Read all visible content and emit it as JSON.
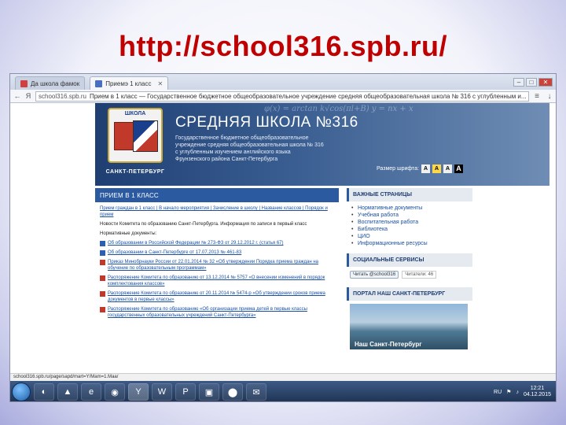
{
  "slide": {
    "title": "http://school316.spb.ru/"
  },
  "browser": {
    "tabs": [
      {
        "label": "Да школа фамок",
        "active": false
      },
      {
        "label": "Приемэ 1 класс",
        "active": true
      }
    ],
    "url_host": "school316.spb.ru",
    "url_title": "Прием в 1 класс — Государственное бюджетное общеобразовательное учреждение средняя общеобразовательная школа № 316 с углубленным и...",
    "status_text": "school316.spb.ru/page/sapd/mart=Y/Mam=1.Maa/"
  },
  "site": {
    "header_formulas": "φ(x) = arctan   k√cos(πl+B)   y = nx + x",
    "emblem_top": "ШКОЛА",
    "emblem_num": "316",
    "city": "САНКТ-ПЕТЕРБУРГ",
    "school_name": "СРЕДНЯЯ ШКОЛА №316",
    "school_desc": "Государственное бюджетное общеобразовательное учреждение средняя общеобразовательная школа № 316 с углубленным изучением английского языка Фрунзенского района Санкт-Петербурга",
    "font_size_label": "Размер шрифта:",
    "font_btns": [
      "А",
      "А",
      "А",
      "А"
    ]
  },
  "main": {
    "heading": "ПРИЕМ В 1 КЛАСС",
    "links_line": "Прием граждан в 1 класс | В начало мероприятия | Зачисление в школу | Название классов | Порядок и прием",
    "committee": "Новости Комитета по образованию Санкт-Петербурга. Информация по записи в первый класс",
    "docs_label": "Нормативные документы:",
    "docs": [
      "Об образовании в Российской Федерации № 273-ФЗ от 29.12.2012 г. (статья 67)",
      "Об образовании в Санкт-Петербурге от 17.07.2013 № 461-83",
      "Приказ Минобрнауки России от 22.01.2014 № 32 «Об утверждении Порядка приема граждан на обучение по образовательным программам»",
      "Распоряжение Комитета по образованию от 13.12.2014 № 5757 «О внесении изменений в порядок комплектования классов»",
      "Распоряжение Комитета по образованию от 20.11.2014 № 5474-р «Об утверждении сроков приема документов в первые классы»",
      "Распоряжение Комитета по образованию «Об организации приема детей в первые классы государственных образовательных учреждений Санкт-Петербурга»"
    ]
  },
  "sidebar": {
    "important_heading": "ВАЖНЫЕ СТРАНИЦЫ",
    "important_items": [
      "Нормативные документы",
      "Учебная работа",
      "Воспитательная работа",
      "Библиотека",
      "ЦИО",
      "Информационные ресурсы"
    ],
    "social_heading": "СОЦИАЛЬНЫЕ СЕРВИСЫ",
    "tweet_label": "Читать @school316",
    "tweet_count": "Читатели: 46",
    "portal_heading": "ПОРТАЛ НАШ САНКТ-ПЕТЕРБУРГ",
    "portal_caption": "Наш Санкт-Петербург"
  },
  "taskbar": {
    "apps": [
      "◐",
      "▲",
      "e",
      "◉",
      "Y",
      "W",
      "P",
      "▣",
      "⬤",
      "✉"
    ],
    "lang": "RU",
    "time": "12:21",
    "date": "04.12.2015"
  }
}
